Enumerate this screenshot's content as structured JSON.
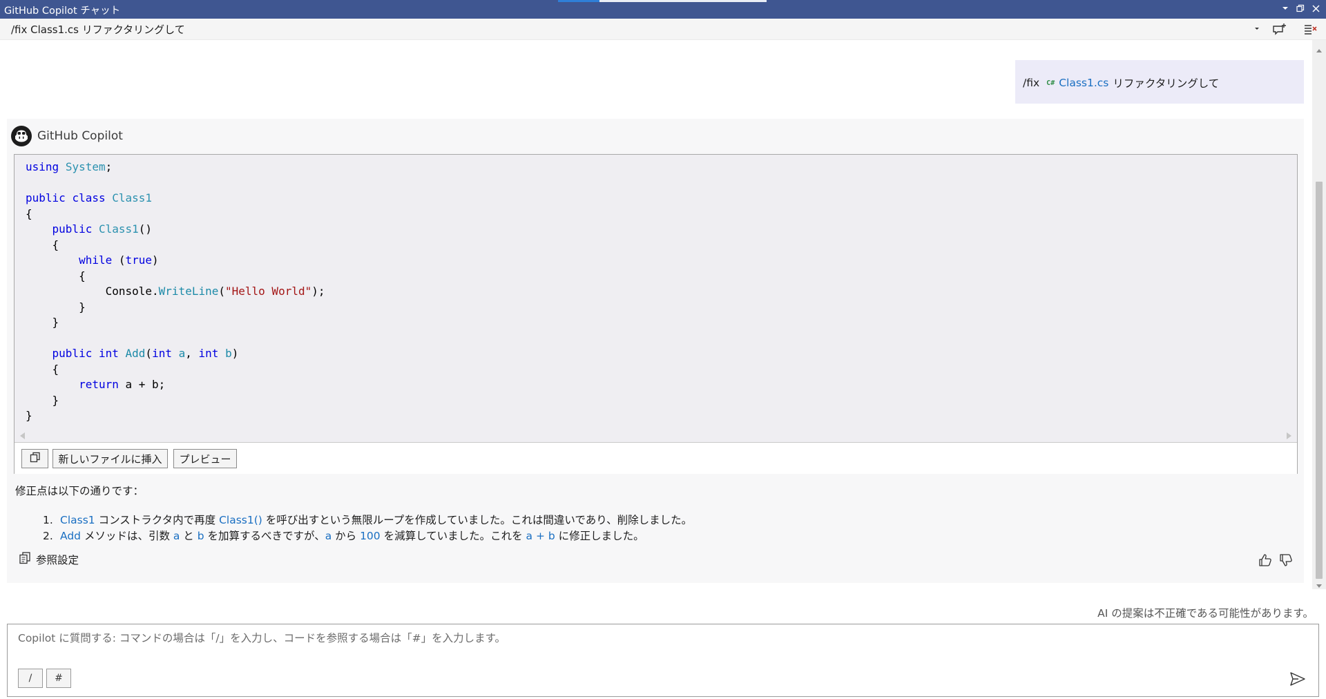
{
  "window": {
    "title": "GitHub Copilot チャット"
  },
  "thread": {
    "title": "/fix Class1.cs リファクタリングして"
  },
  "user_message": {
    "command": "/fix",
    "file_badge": "C#",
    "file_name": "Class1.cs",
    "text": "リファクタリングして"
  },
  "response": {
    "author": "GitHub Copilot",
    "code_lines": [
      [
        {
          "t": "using",
          "c": "kw"
        },
        {
          "t": " "
        },
        {
          "t": "System",
          "c": "ty"
        },
        {
          "t": ";"
        }
      ],
      [],
      [
        {
          "t": "public",
          "c": "kw"
        },
        {
          "t": " "
        },
        {
          "t": "class",
          "c": "kw"
        },
        {
          "t": " "
        },
        {
          "t": "Class1",
          "c": "ty"
        }
      ],
      [
        {
          "t": "{"
        }
      ],
      [
        {
          "t": "    "
        },
        {
          "t": "public",
          "c": "kw"
        },
        {
          "t": " "
        },
        {
          "t": "Class1",
          "c": "ty"
        },
        {
          "t": "()"
        }
      ],
      [
        {
          "t": "    {"
        }
      ],
      [
        {
          "t": "        "
        },
        {
          "t": "while",
          "c": "kw"
        },
        {
          "t": " ("
        },
        {
          "t": "true",
          "c": "kw"
        },
        {
          "t": ")"
        }
      ],
      [
        {
          "t": "        {"
        }
      ],
      [
        {
          "t": "            Console."
        },
        {
          "t": "WriteLine",
          "c": "mt"
        },
        {
          "t": "("
        },
        {
          "t": "\"Hello World\"",
          "c": "st"
        },
        {
          "t": ");"
        }
      ],
      [
        {
          "t": "        }"
        }
      ],
      [
        {
          "t": "    }"
        }
      ],
      [],
      [
        {
          "t": "    "
        },
        {
          "t": "public",
          "c": "kw"
        },
        {
          "t": " "
        },
        {
          "t": "int",
          "c": "kw"
        },
        {
          "t": " "
        },
        {
          "t": "Add",
          "c": "mt"
        },
        {
          "t": "("
        },
        {
          "t": "int",
          "c": "kw"
        },
        {
          "t": " "
        },
        {
          "t": "a",
          "c": "pr"
        },
        {
          "t": ", "
        },
        {
          "t": "int",
          "c": "kw"
        },
        {
          "t": " "
        },
        {
          "t": "b",
          "c": "pr"
        },
        {
          "t": ")"
        }
      ],
      [
        {
          "t": "    {"
        }
      ],
      [
        {
          "t": "        "
        },
        {
          "t": "return",
          "c": "kw"
        },
        {
          "t": " a + b;"
        }
      ],
      [
        {
          "t": "    }"
        }
      ],
      [
        {
          "t": "}"
        }
      ]
    ],
    "code_actions": {
      "copy_icon": "copy-icon",
      "insert_new_file": "新しいファイルに挿入",
      "preview": "プレビュー"
    },
    "fix_intro": "修正点は以下の通りです：",
    "fixes": [
      {
        "num": "1.",
        "segments": [
          {
            "t": "Class1",
            "ref": true
          },
          {
            "t": " コンストラクタ内で再度 "
          },
          {
            "t": "Class1()",
            "ref": true
          },
          {
            "t": " を呼び出すという無限ループを作成していました。これは間違いであり、削除しました。"
          }
        ]
      },
      {
        "num": "2.",
        "segments": [
          {
            "t": "Add",
            "ref": true
          },
          {
            "t": " メソッドは、引数 "
          },
          {
            "t": "a",
            "ref": true
          },
          {
            "t": " と "
          },
          {
            "t": "b",
            "ref": true
          },
          {
            "t": " を加算するべきですが、"
          },
          {
            "t": "a",
            "ref": true
          },
          {
            "t": " から "
          },
          {
            "t": "100",
            "ref": true
          },
          {
            "t": " を減算していました。これを "
          },
          {
            "t": "a + b",
            "ref": true
          },
          {
            "t": " に修正しました。"
          }
        ]
      }
    ],
    "references_label": "参照設定"
  },
  "disclaimer": "AI の提案は不正確である可能性があります。",
  "chat_input": {
    "placeholder": "Copilot に質問する: コマンドの場合は「/」を入力し、コードを参照する場合は「#」を入力します。",
    "slash_button": "/",
    "hash_button": "#"
  },
  "colors": {
    "titlebar": "#3f5691",
    "link": "#1a6fc2",
    "keyword": "#0000e0",
    "type": "#2b91af",
    "string": "#a31515",
    "user_bubble": "#ecebf8"
  }
}
